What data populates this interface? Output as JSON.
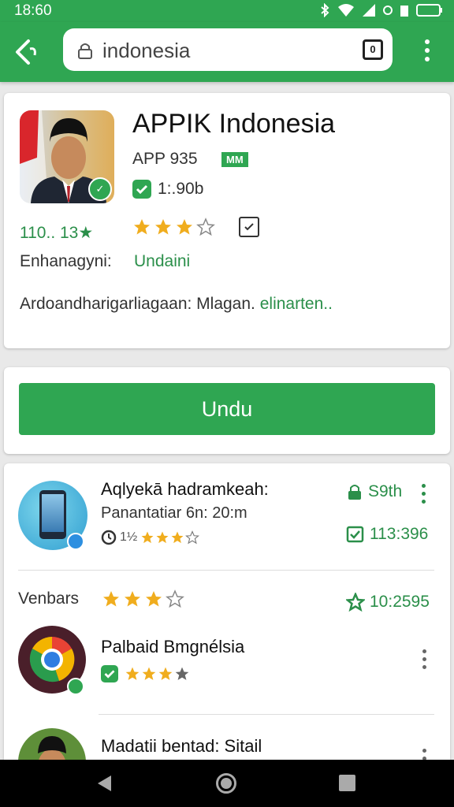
{
  "status_bar": {
    "time": "18:60",
    "icons": [
      "bluetooth-icon",
      "wifi-icon",
      "signal-icon",
      "battery-icon"
    ]
  },
  "toolbar": {
    "back_icon": "back-arrow-icon",
    "url": "indonesia",
    "tab_count": "0",
    "menu_icon": "more-vert-icon"
  },
  "app": {
    "name": "APPIK Indonesia",
    "version": "APP 935",
    "badge": "MM",
    "size": "1:.90b",
    "rating_text": "110.. 13★",
    "stars": 3,
    "developer_label": "Enhanagyni:",
    "developer_value": "Undaini",
    "description": "Ardoandharigarliagaan: Mlagan.",
    "description_more": "elinarten.."
  },
  "install": {
    "label": "Undu"
  },
  "list": {
    "items": [
      {
        "title": "Aqlyekā hadramkeah:",
        "subtitle": "Panantatiar 6n: 20:m",
        "rating_prefix": "1½",
        "stars": 3,
        "stat_top": "S9th",
        "stat_bottom": "113:396"
      },
      {
        "label": "Venbars",
        "stars": 3,
        "stat": "10:2595"
      },
      {
        "title": "Palbaid Bmgnélsia",
        "stars": 3
      },
      {
        "title": "Madatii bentad: Sitail"
      }
    ]
  },
  "colors": {
    "brand_green": "#2fa652",
    "text_green": "#2b8f4a",
    "star_gold": "#f0ad1e"
  },
  "nav": {
    "icons": [
      "nav-back-icon",
      "nav-home-icon",
      "nav-recent-icon"
    ]
  }
}
